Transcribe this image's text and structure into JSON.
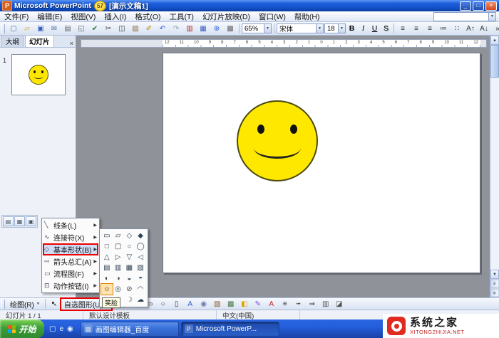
{
  "glyphs": {
    "dropdown": "▼",
    "submenu_arrow": "▶",
    "close": "×",
    "minimize": "_",
    "maximize": "□",
    "scroll_up": "▲",
    "scroll_down": "▼",
    "prev_slide": "«",
    "next_slide": "»"
  },
  "title_bar": {
    "app_icon_letter": "P",
    "app_title": "Microsoft PowerPoint",
    "badge": "57",
    "doc_title": "[演示文稿1]"
  },
  "menu_bar": {
    "items": [
      "文件(F)",
      "编辑(E)",
      "视图(V)",
      "插入(I)",
      "格式(O)",
      "工具(T)",
      "幻灯片放映(D)",
      "窗口(W)",
      "帮助(H)"
    ]
  },
  "standard_toolbar": {
    "zoom": "65%",
    "icons": [
      {
        "name": "new-document-icon",
        "glyph": "▢",
        "color": "#4a6fb0"
      },
      {
        "name": "open-icon",
        "glyph": "▱",
        "color": "#d9a53b"
      },
      {
        "name": "save-icon",
        "glyph": "▣",
        "color": "#3b5fc0"
      },
      {
        "name": "email-icon",
        "glyph": "✉",
        "color": "#5b7aa9"
      },
      {
        "name": "print-icon",
        "glyph": "▤",
        "color": "#666666"
      },
      {
        "name": "print-preview-icon",
        "glyph": "◱",
        "color": "#666666"
      },
      {
        "name": "spelling-icon",
        "glyph": "✔",
        "color": "#2c7a2c"
      },
      {
        "name": "cut-icon",
        "glyph": "✂",
        "color": "#444444"
      },
      {
        "name": "copy-icon",
        "glyph": "◫",
        "color": "#444444"
      },
      {
        "name": "paste-icon",
        "glyph": "▨",
        "color": "#8a6d3b"
      },
      {
        "name": "format-painter-icon",
        "glyph": "✐",
        "color": "#b58900"
      },
      {
        "name": "undo-icon",
        "glyph": "↶",
        "color": "#2f5bd8"
      },
      {
        "name": "redo-icon",
        "glyph": "↷",
        "color": "#8899aa"
      },
      {
        "name": "insert-chart-icon",
        "glyph": "▥",
        "color": "#b03030"
      },
      {
        "name": "insert-table-icon",
        "glyph": "▦",
        "color": "#3b5fc0"
      },
      {
        "name": "insert-hyperlink-icon",
        "glyph": "⊕",
        "color": "#2f5bd8"
      },
      {
        "name": "show-grid-icon",
        "glyph": "▩",
        "color": "#666666"
      }
    ]
  },
  "formatting_toolbar": {
    "font_name": "宋体",
    "font_size": "18",
    "bold": "B",
    "italic": "I",
    "underline": "U",
    "shadow": "S",
    "icons": [
      {
        "name": "align-left-icon",
        "glyph": "≡",
        "color": "#333333"
      },
      {
        "name": "align-center-icon",
        "glyph": "≡",
        "color": "#333333"
      },
      {
        "name": "align-right-icon",
        "glyph": "≡",
        "color": "#333333"
      },
      {
        "name": "numbering-icon",
        "glyph": "≔",
        "color": "#333333"
      },
      {
        "name": "bullets-icon",
        "glyph": "∷",
        "color": "#333333"
      },
      {
        "name": "increase-font-size-icon",
        "glyph": "A↑",
        "color": "#333333"
      },
      {
        "name": "decrease-font-size-icon",
        "glyph": "A↓",
        "color": "#333333"
      },
      {
        "name": "toolbar-options-icon",
        "glyph": "»",
        "color": "#333333"
      }
    ]
  },
  "left_pane": {
    "tabs": [
      {
        "label": "大纲"
      },
      {
        "label": "幻灯片",
        "active": true
      }
    ],
    "slide_number": "1"
  },
  "ruler_numbers": "12 11 10 9 8 7 6 5 4 3 2 1 0 1 2 3 4 5 6 7 8 9 10 11 12",
  "autoshapes_menu": {
    "items": [
      {
        "name": "autoshapes-item-lines",
        "icon": "╲",
        "label": "线条(L)"
      },
      {
        "name": "autoshapes-item-connectors",
        "icon": "∿",
        "label": "连接符(X)"
      },
      {
        "name": "autoshapes-item-basic-shapes",
        "icon": "◇",
        "label": "基本形状(B)",
        "highlighted": true
      },
      {
        "name": "autoshapes-item-block-arrows",
        "icon": "⇨",
        "label": "箭头总汇(A)"
      },
      {
        "name": "autoshapes-item-flowchart",
        "icon": "▭",
        "label": "流程图(F)"
      },
      {
        "name": "autoshapes-item-action-buttons",
        "icon": "⊡",
        "label": "动作按钮(I)"
      }
    ]
  },
  "shapes_palette": {
    "shapes": [
      "▭",
      "▱",
      "◇",
      "◆",
      "□",
      "▢",
      "○",
      "◯",
      "△",
      "▷",
      "▽",
      "◁",
      "▤",
      "▥",
      "▦",
      "▧",
      "◐",
      "◑",
      "◒",
      "◓",
      "☺",
      "◎",
      "⊘",
      "◠",
      "♥",
      "☀",
      "☽",
      "☁"
    ],
    "selected_index": 20,
    "tooltip": "笑脸"
  },
  "drawing_toolbar": {
    "draw_label": "绘图(R)",
    "select_glyph": "↖",
    "autoshapes_label": "自选图形(U)",
    "icons": [
      {
        "name": "line-icon",
        "glyph": "╲",
        "color": "#333333"
      },
      {
        "name": "arrow-icon",
        "glyph": "↘",
        "color": "#333333"
      },
      {
        "name": "rectangle-icon",
        "glyph": "▭",
        "color": "#333333"
      },
      {
        "name": "oval-icon",
        "glyph": "○",
        "color": "#333333"
      },
      {
        "name": "text-box-icon",
        "glyph": "▯",
        "color": "#333333"
      },
      {
        "name": "wordart-icon",
        "glyph": "A",
        "color": "#2f5bd8"
      },
      {
        "name": "diagram-icon",
        "glyph": "◉",
        "color": "#6a7ab0"
      },
      {
        "name": "clip-art-icon",
        "glyph": "▧",
        "color": "#8a5a2b"
      },
      {
        "name": "insert-picture-icon",
        "glyph": "▩",
        "color": "#4a7a4a"
      },
      {
        "name": "fill-color-icon",
        "glyph": "◧",
        "color": "#d8a800"
      },
      {
        "name": "line-color-icon",
        "glyph": "✎",
        "color": "#7a4ad8"
      },
      {
        "name": "font-color-icon",
        "glyph": "A",
        "color": "#cc2222"
      },
      {
        "name": "line-style-icon",
        "glyph": "≡",
        "color": "#333333"
      },
      {
        "name": "dash-style-icon",
        "glyph": "┅",
        "color": "#333333"
      },
      {
        "name": "arrow-style-icon",
        "glyph": "⇒",
        "color": "#333333"
      },
      {
        "name": "shadow-style-icon",
        "glyph": "▥",
        "color": "#555555"
      },
      {
        "name": "threed-style-icon",
        "glyph": "◪",
        "color": "#555555"
      }
    ]
  },
  "status_bar": {
    "slide_info": "幻灯片 1 / 1",
    "design_template": "默认设计模板",
    "language": "中文(中国)"
  },
  "view_buttons": [
    {
      "name": "normal-view-icon",
      "glyph": "▤"
    },
    {
      "name": "slide-sorter-view-icon",
      "glyph": "▦"
    },
    {
      "name": "slideshow-view-icon",
      "glyph": "▣"
    }
  ],
  "taskbar": {
    "start_label": "开始",
    "quick_launch": [
      {
        "name": "show-desktop-icon",
        "glyph": "▢"
      },
      {
        "name": "internet-explorer-icon",
        "glyph": "e"
      },
      {
        "name": "media-player-icon",
        "glyph": "◉"
      }
    ],
    "tasks": [
      {
        "icon": "▨",
        "label": "画图编辑器_百度"
      },
      {
        "icon": "P",
        "label": "Microsoft PowerP...",
        "active": true
      }
    ]
  },
  "watermark": {
    "site_name": "系统之家",
    "site_url": "XITONGZHIJIA.NET"
  }
}
